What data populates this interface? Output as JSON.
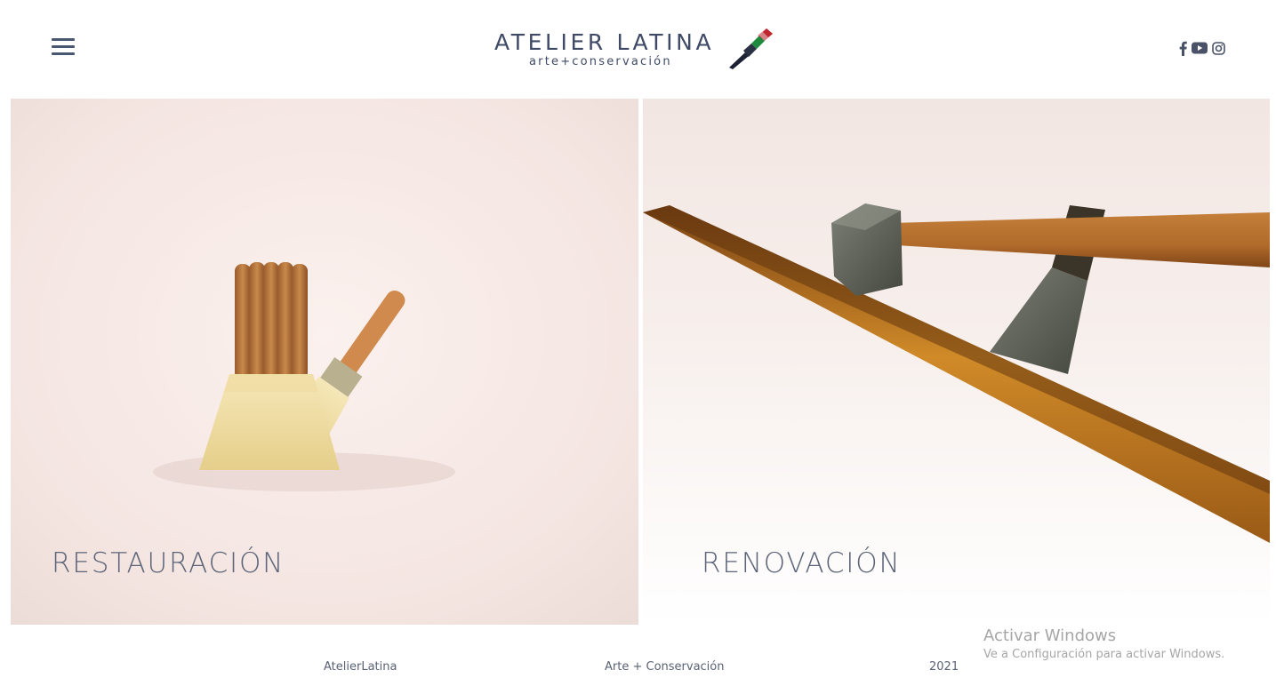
{
  "header": {
    "menu_icon": "hamburger-menu-icon",
    "logo": {
      "title": "ATELIER LATINA",
      "subtitle": "arte+conservación",
      "icon": "paintbrush-icon"
    },
    "social": [
      {
        "name": "facebook",
        "icon": "facebook-icon"
      },
      {
        "name": "youtube",
        "icon": "youtube-icon"
      },
      {
        "name": "instagram",
        "icon": "instagram-icon"
      }
    ]
  },
  "panels": [
    {
      "label": "RESTAURACIÓN",
      "image": "paintbrushes-photo"
    },
    {
      "label": "RENOVACIÓN",
      "image": "hammer-chisel-wood-photo"
    }
  ],
  "footer": {
    "brand": "AtelierLatina",
    "tagline": "Arte + Conservación",
    "year": "2021"
  },
  "windows_watermark": {
    "title": "Activar Windows",
    "subtitle": "Ve a Configuración para activar Windows."
  },
  "colors": {
    "text_primary": "#3f4a66",
    "panel_label": "#5b6478",
    "brush_red": "#c0272d",
    "brush_green": "#1e8a3e"
  }
}
